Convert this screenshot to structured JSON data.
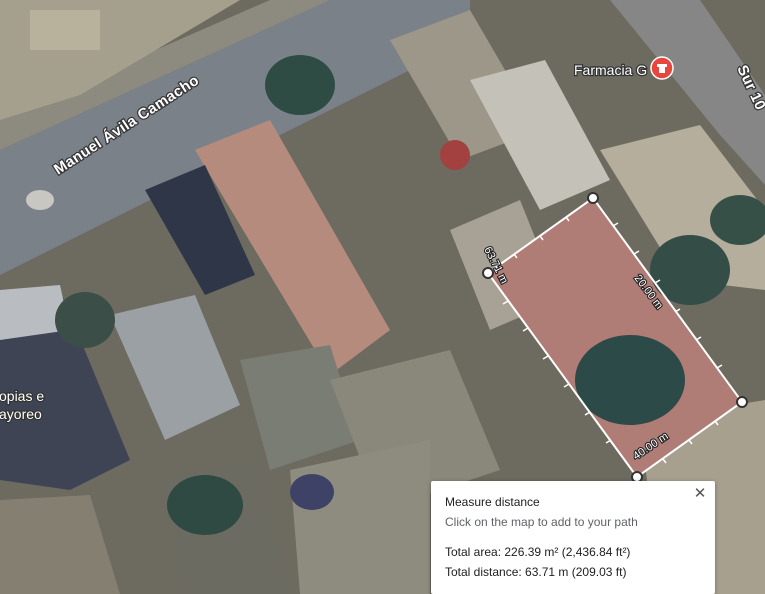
{
  "map": {
    "roads": [
      {
        "id": "manuel-avila-camacho",
        "label": "Manuel Ávila Camacho"
      },
      {
        "id": "sur",
        "label": "Sur 10"
      }
    ],
    "places": [
      {
        "id": "farmacia",
        "label": "Farmacia G",
        "icon": "pharmacy-pin-icon",
        "pin_color": "#e8453c"
      },
      {
        "id": "copias",
        "label_lines": [
          "opias e",
          "ayoreo"
        ]
      }
    ],
    "measurement": {
      "segment_labels": [
        "63.71 m",
        "20.00 m",
        "40.00 m"
      ],
      "line_color": "#ffffff"
    }
  },
  "measure_panel": {
    "title": "Measure distance",
    "hint": "Click on the map to add to your path",
    "total_area": "Total area: 226.39 m² (2,436.84 ft²)",
    "total_distance": "Total distance: 63.71 m (209.03 ft)",
    "close_icon": "close-icon"
  }
}
